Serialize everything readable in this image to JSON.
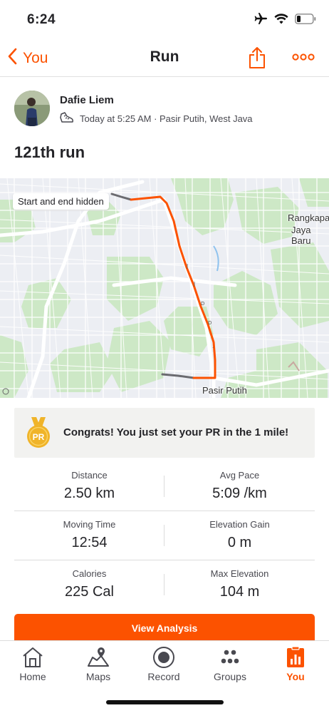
{
  "status_bar": {
    "time": "6:24",
    "icons": [
      "airplane-icon",
      "wifi-icon",
      "battery-icon"
    ]
  },
  "nav": {
    "back_label": "You",
    "title": "Run",
    "share_icon": "share-icon",
    "more_icon": "more-icon"
  },
  "athlete": {
    "name": "Dafie Liem",
    "meta": "Today at 5:25 AM · Pasir Putih, West Java",
    "activity_icon": "shoe-icon"
  },
  "activity": {
    "title": "121th run"
  },
  "map": {
    "badge": "Start and end hidden",
    "labels": {
      "rangkapan": "Rangkapan",
      "jaya_baru": "Jaya Baru",
      "pasir_putih": "Pasir Putih"
    }
  },
  "achievement": {
    "badge_text": "PR",
    "text": "Congrats! You just set your PR in the 1 mile!"
  },
  "stats": [
    {
      "left_label": "Distance",
      "left_value": "2.50 km",
      "right_label": "Avg Pace",
      "right_value": "5:09 /km"
    },
    {
      "left_label": "Moving Time",
      "left_value": "12:54",
      "right_label": "Elevation Gain",
      "right_value": "0 m"
    },
    {
      "left_label": "Calories",
      "left_value": "225 Cal",
      "right_label": "Max Elevation",
      "right_value": "104 m"
    }
  ],
  "actions": {
    "view_analysis": "View Analysis"
  },
  "tabbar": {
    "tabs": [
      {
        "label": "Home",
        "icon": "home-icon"
      },
      {
        "label": "Maps",
        "icon": "maps-icon"
      },
      {
        "label": "Record",
        "icon": "record-icon"
      },
      {
        "label": "Groups",
        "icon": "groups-icon"
      },
      {
        "label": "You",
        "icon": "you-icon"
      }
    ],
    "active": "You"
  },
  "colors": {
    "brand": "#fc5200",
    "text": "#242428",
    "map_green": "#cde8c6",
    "route": "#fc5200"
  }
}
